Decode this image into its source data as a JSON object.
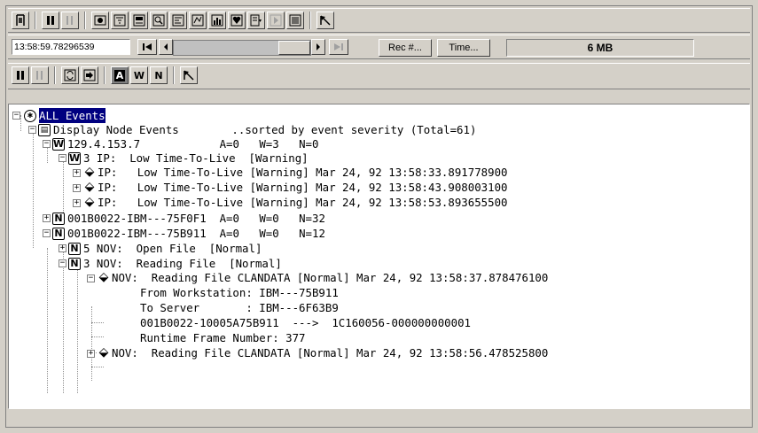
{
  "toolbar2": {
    "time_value": "13:58:59.78296539",
    "rec_label": "Rec #...",
    "time_label": "Time...",
    "memory": "6 MB"
  },
  "toolbar3": {
    "a_label": "A",
    "w_label": "W",
    "n_label": "N"
  },
  "tree": {
    "root": "ALL Events",
    "display": "Display Node Events        ..sorted by event severity (Total=61)",
    "node1": "129.4.153.7            A=0   W=3   N=0",
    "node1_group": "3 IP:  Low Time-To-Live  [Warning]",
    "node1_e1": "IP:   Low Time-To-Live [Warning] Mar 24, 92 13:58:33.891778900",
    "node1_e2": "IP:   Low Time-To-Live [Warning] Mar 24, 92 13:58:43.908003100",
    "node1_e3": "IP:   Low Time-To-Live [Warning] Mar 24, 92 13:58:53.893655500",
    "node2": "001B0022-IBM---75F0F1  A=0   W=0   N=32",
    "node3": "001B0022-IBM---75B911  A=0   W=0   N=12",
    "node3_g1": "5 NOV:  Open File  [Normal]",
    "node3_g2": "3 NOV:  Reading File  [Normal]",
    "node3_e1": "NOV:  Reading File CLANDATA [Normal] Mar 24, 92 13:58:37.878476100",
    "detail1": "From Workstation: IBM---75B911",
    "detail2": "To Server       : IBM---6F63B9",
    "detail3": "001B0022-10005A75B911  --->  1C160056-000000000001",
    "detail4": "Runtime Frame Number: 377",
    "node3_e2": "NOV:  Reading File CLANDATA [Normal] Mar 24, 92 13:58:56.478525800"
  },
  "icons": {
    "node_warning": "W",
    "node_normal": "N",
    "event": "event-icon"
  }
}
